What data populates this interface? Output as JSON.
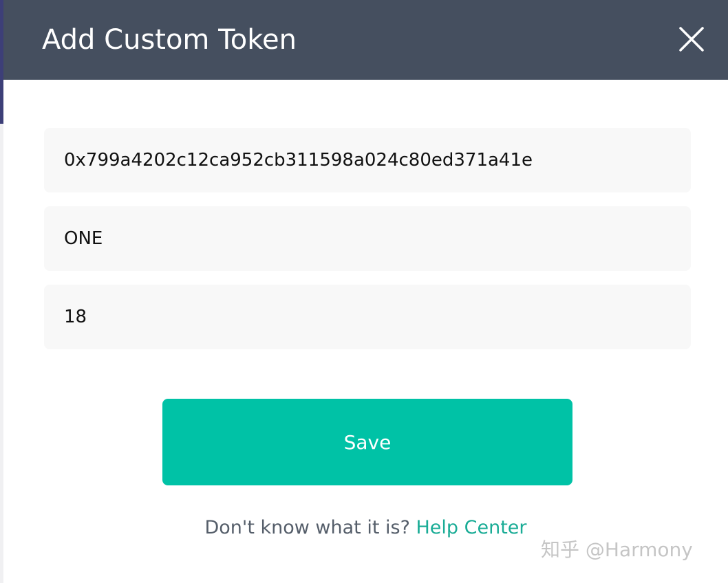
{
  "modal": {
    "title": "Add Custom Token",
    "close_icon": "close-icon"
  },
  "form": {
    "address_value": "0x799a4202c12ca952cb311598a024c80ed371a41e",
    "symbol_value": "ONE",
    "decimals_value": "18",
    "save_label": "Save"
  },
  "help": {
    "text": "Don't know what it is?",
    "link_label": "Help Center"
  },
  "watermark": {
    "text": "知乎 @Harmony"
  },
  "colors": {
    "header_bg": "#454f5f",
    "accent": "#00c2a6",
    "link": "#1aac96",
    "field_bg": "#f8f8f8"
  }
}
